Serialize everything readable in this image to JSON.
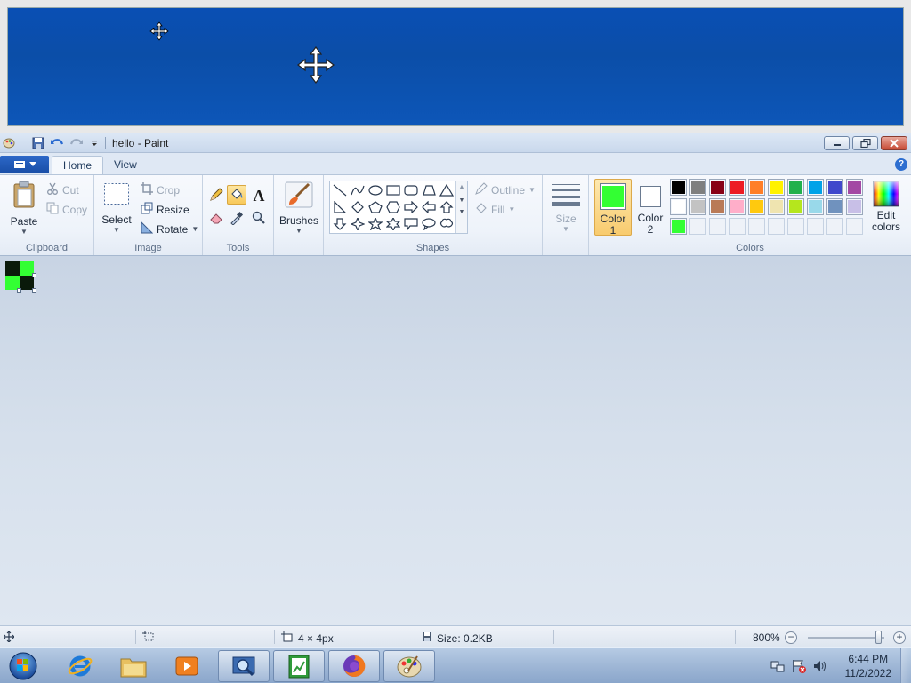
{
  "window": {
    "title": "hello - Paint"
  },
  "ribbon_tabs": [
    {
      "label": "Home"
    },
    {
      "label": "View"
    }
  ],
  "clipboard": {
    "paste_label": "Paste",
    "cut_label": "Cut",
    "copy_label": "Copy",
    "group_label": "Clipboard"
  },
  "image": {
    "select_label": "Select",
    "crop_label": "Crop",
    "resize_label": "Resize",
    "rotate_label": "Rotate",
    "group_label": "Image"
  },
  "tools": {
    "group_label": "Tools",
    "text_tool_glyph": "A"
  },
  "brushes": {
    "label": "Brushes"
  },
  "shapes": {
    "outline_label": "Outline",
    "fill_label": "Fill",
    "group_label": "Shapes"
  },
  "size": {
    "label": "Size"
  },
  "colors": {
    "color1_label": "Color",
    "color1_num": "1",
    "color2_label": "Color",
    "color2_num": "2",
    "edit_label": "Edit",
    "edit_label2": "colors",
    "group_label": "Colors",
    "color1_value": "#33ff33",
    "color2_value": "#ffffff",
    "palette_row1": [
      "#000000",
      "#7f7f7f",
      "#880015",
      "#ed1c24",
      "#ff7f27",
      "#fff200",
      "#22b14c",
      "#00a2e8",
      "#3f48cc",
      "#a349a4"
    ],
    "palette_row2": [
      "#ffffff",
      "#c3c3c3",
      "#b97a57",
      "#ffaec9",
      "#ffc90e",
      "#efe4b0",
      "#b5e61d",
      "#99d9ea",
      "#7092be",
      "#c8bfe7"
    ],
    "palette_row3": [
      "#33ff33"
    ]
  },
  "canvas": {
    "pixels": [
      "#0a1a0a",
      "#33ff33",
      "#33ff33",
      "#0a1a0a"
    ]
  },
  "status": {
    "dimensions": "4 × 4px",
    "size": "Size: 0.2KB",
    "zoom": "800%",
    "zoom_fraction": 0.93
  },
  "taskbar": {
    "time": "6:44 PM",
    "date": "11/2/2022"
  }
}
